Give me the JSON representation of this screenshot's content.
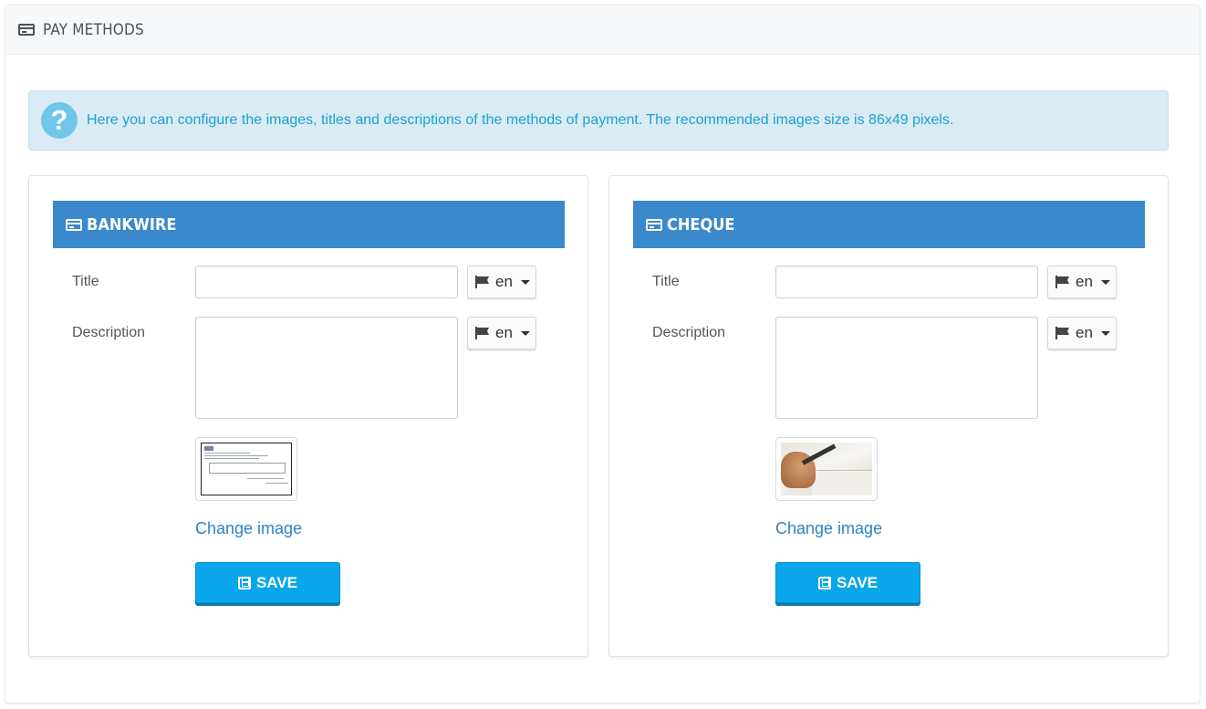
{
  "panel": {
    "title": "PAY METHODS",
    "icon": "credit-card-icon"
  },
  "alert": {
    "icon": "question-icon",
    "icon_glyph": "?",
    "message": "Here you can configure the images, titles and descriptions of the methods of payment. The recommended images size is 86x49 pixels."
  },
  "methods": [
    {
      "name": "BANKWIRE",
      "title_label": "Title",
      "title_value": "",
      "description_label": "Description",
      "description_value": "",
      "lang_title": "en",
      "lang_description": "en",
      "change_image": "Change image",
      "save_label": "SAVE"
    },
    {
      "name": "CHEQUE",
      "title_label": "Title",
      "title_value": "",
      "description_label": "Description",
      "description_value": "",
      "lang_title": "en",
      "lang_description": "en",
      "change_image": "Change image",
      "save_label": "SAVE"
    }
  ],
  "colors": {
    "header_blue": "#3a89cc",
    "save_button": "#0aa6eb",
    "alert_bg": "#d9ecf6",
    "alert_text": "#1ba2cc",
    "link": "#2d83c6"
  }
}
